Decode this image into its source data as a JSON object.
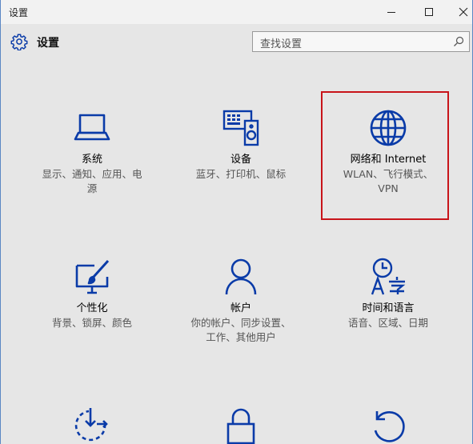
{
  "window": {
    "title": "设置"
  },
  "header": {
    "title": "设置",
    "icon": "gear-icon"
  },
  "search": {
    "placeholder": "查找设置",
    "icon": "search-icon"
  },
  "colors": {
    "accent": "#0a3ba8",
    "highlight_border": "#c8141a",
    "background": "#e6e6e6"
  },
  "tiles": [
    {
      "title": "系统",
      "desc_lines": [
        "显示、通知、应用、电",
        "源"
      ],
      "icon": "laptop-icon"
    },
    {
      "title": "设备",
      "desc_lines": [
        "蓝牙、打印机、鼠标"
      ],
      "icon": "devices-icon"
    },
    {
      "title": "网络和 Internet",
      "desc_lines": [
        "WLAN、飞行模式、",
        "VPN"
      ],
      "icon": "globe-icon"
    },
    {
      "title": "个性化",
      "desc_lines": [
        "背景、锁屏、颜色"
      ],
      "icon": "personalization-icon"
    },
    {
      "title": "帐户",
      "desc_lines": [
        "你的帐户、同步设置、",
        "工作、其他用户"
      ],
      "icon": "person-icon"
    },
    {
      "title": "时间和语言",
      "desc_lines": [
        "语音、区域、日期"
      ],
      "icon": "time-language-icon"
    },
    {
      "title": "",
      "desc_lines": [],
      "icon": "ease-of-access-icon"
    },
    {
      "title": "",
      "desc_lines": [],
      "icon": "lock-icon"
    },
    {
      "title": "",
      "desc_lines": [],
      "icon": "update-icon"
    }
  ]
}
